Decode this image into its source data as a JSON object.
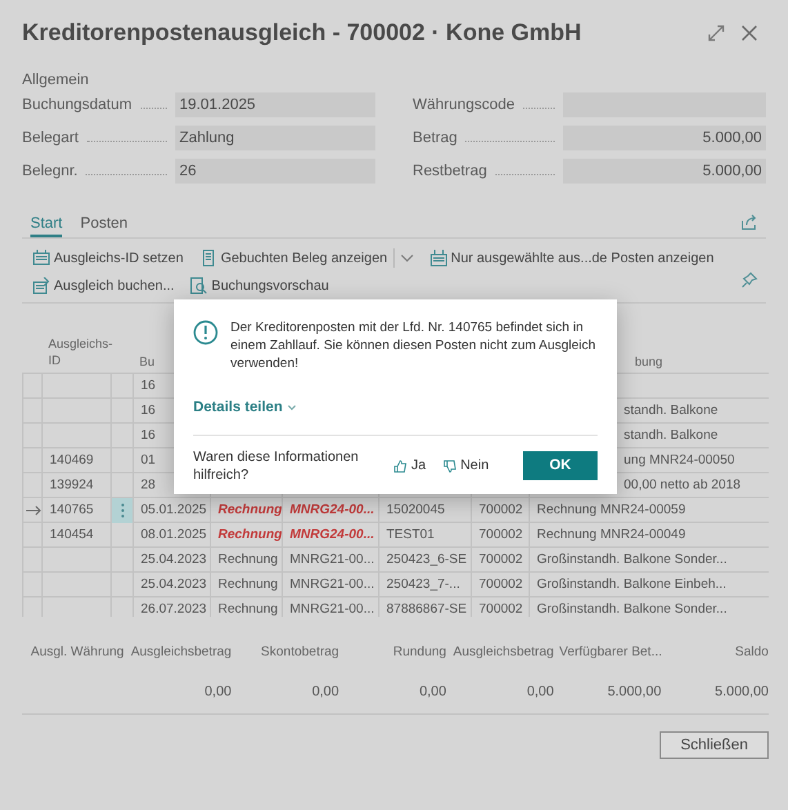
{
  "window": {
    "title": "Kreditorenpostenausgleich - 700002 · Kone GmbH"
  },
  "general": {
    "heading": "Allgemein",
    "left_fields": [
      {
        "label": "Buchungsdatum",
        "value": "19.01.2025"
      },
      {
        "label": "Belegart",
        "value": "Zahlung"
      },
      {
        "label": "Belegnr.",
        "value": "26"
      }
    ],
    "right_fields": [
      {
        "label": "Währungscode"
      },
      {
        "label": "Betrag",
        "value": "5.000,00"
      },
      {
        "label": "Restbetrag",
        "value": "5.000,00"
      }
    ]
  },
  "tabs": [
    {
      "label": "Start",
      "selected": true
    },
    {
      "label": "Posten",
      "selected": false
    }
  ],
  "actions": [
    {
      "label": "Ausgleichs-ID setzen",
      "dropdown": false
    },
    {
      "label": "Gebuchten Beleg anzeigen",
      "dropdown": true
    },
    {
      "label": "Nur ausgewählte aus...de Posten anzeigen",
      "dropdown": false
    },
    {
      "label": "Ausgleich buchen...",
      "dropdown": false
    },
    {
      "label": "Buchungsvorschau",
      "dropdown": false
    }
  ],
  "table": {
    "header": {
      "column_1": "Ausgleichs-ID",
      "column_3": "Bu",
      "column_8": "bung"
    },
    "rows": [
      {
        "selected": false,
        "emphasized": false,
        "column_3": "16"
      },
      {
        "selected": false,
        "emphasized": false,
        "column_3": "16",
        "column_8": "standh. Balkone"
      },
      {
        "selected": false,
        "emphasized": false,
        "column_3": "16",
        "column_8": "standh. Balkone"
      },
      {
        "selected": false,
        "emphasized": false,
        "column_1": "140469",
        "column_3": "01",
        "column_8": "ung MNR24-00050"
      },
      {
        "selected": false,
        "emphasized": false,
        "column_1": "139924",
        "column_3": "28",
        "column_8": "00,00 netto ab 2018"
      },
      {
        "selected": true,
        "emphasized": true,
        "column_1": "140765",
        "column_3": "05.01.2025",
        "column_4": "Rechnung",
        "column_5": "MNRG24-00...",
        "column_6": "15020045",
        "column_7": "700002",
        "column_8": "Rechnung MNR24-00059"
      },
      {
        "selected": false,
        "emphasized": true,
        "column_1": "140454",
        "column_3": "08.01.2025",
        "column_4": "Rechnung",
        "column_5": "MNRG24-00...",
        "column_6": "TEST01",
        "column_7": "700002",
        "column_8": "Rechnung MNR24-00049"
      },
      {
        "selected": false,
        "emphasized": false,
        "column_3": "25.04.2023",
        "column_4": "Rechnung",
        "column_5": "MNRG21-00...",
        "column_6": "250423_6-SE",
        "column_7": "700002",
        "column_8": "Großinstandh. Balkone Sonder..."
      },
      {
        "selected": false,
        "emphasized": false,
        "column_3": "25.04.2023",
        "column_4": "Rechnung",
        "column_5": "MNRG21-00...",
        "column_6": "250423_7-...",
        "column_7": "700002",
        "column_8": "Großinstandh. Balkone Einbeh..."
      },
      {
        "selected": false,
        "emphasized": false,
        "column_3": "26.07.2023",
        "column_4": "Rechnung",
        "column_5": "MNRG21-00...",
        "column_6": "87886867-SE",
        "column_7": "700002",
        "column_8": "Großinstandh. Balkone Sonder..."
      }
    ]
  },
  "totals": [
    {
      "label": "Ausgl. Währung"
    },
    {
      "label": "Ausgleichsbetrag",
      "value": "0,00"
    },
    {
      "label": "Skontobetrag",
      "value": "0,00"
    },
    {
      "label": "Rundung",
      "value": "0,00"
    },
    {
      "label": "Ausgleichsbetrag",
      "value": "0,00"
    },
    {
      "label": "Verfügbarer Bet...",
      "value": "5.000,00"
    },
    {
      "label": "Saldo",
      "value": "5.000,00"
    }
  ],
  "close_button": "Schließen",
  "dialog": {
    "message": "Der Kreditorenposten mit der Lfd. Nr. 140765 befindet sich in einem Zahllauf. Sie können diesen Posten nicht zum Ausgleich verwenden!",
    "details_link": "Details teilen",
    "feedback_question": "Waren diese Informationen hilfreich?",
    "yes": "Ja",
    "no": "Nein",
    "ok": "OK"
  }
}
